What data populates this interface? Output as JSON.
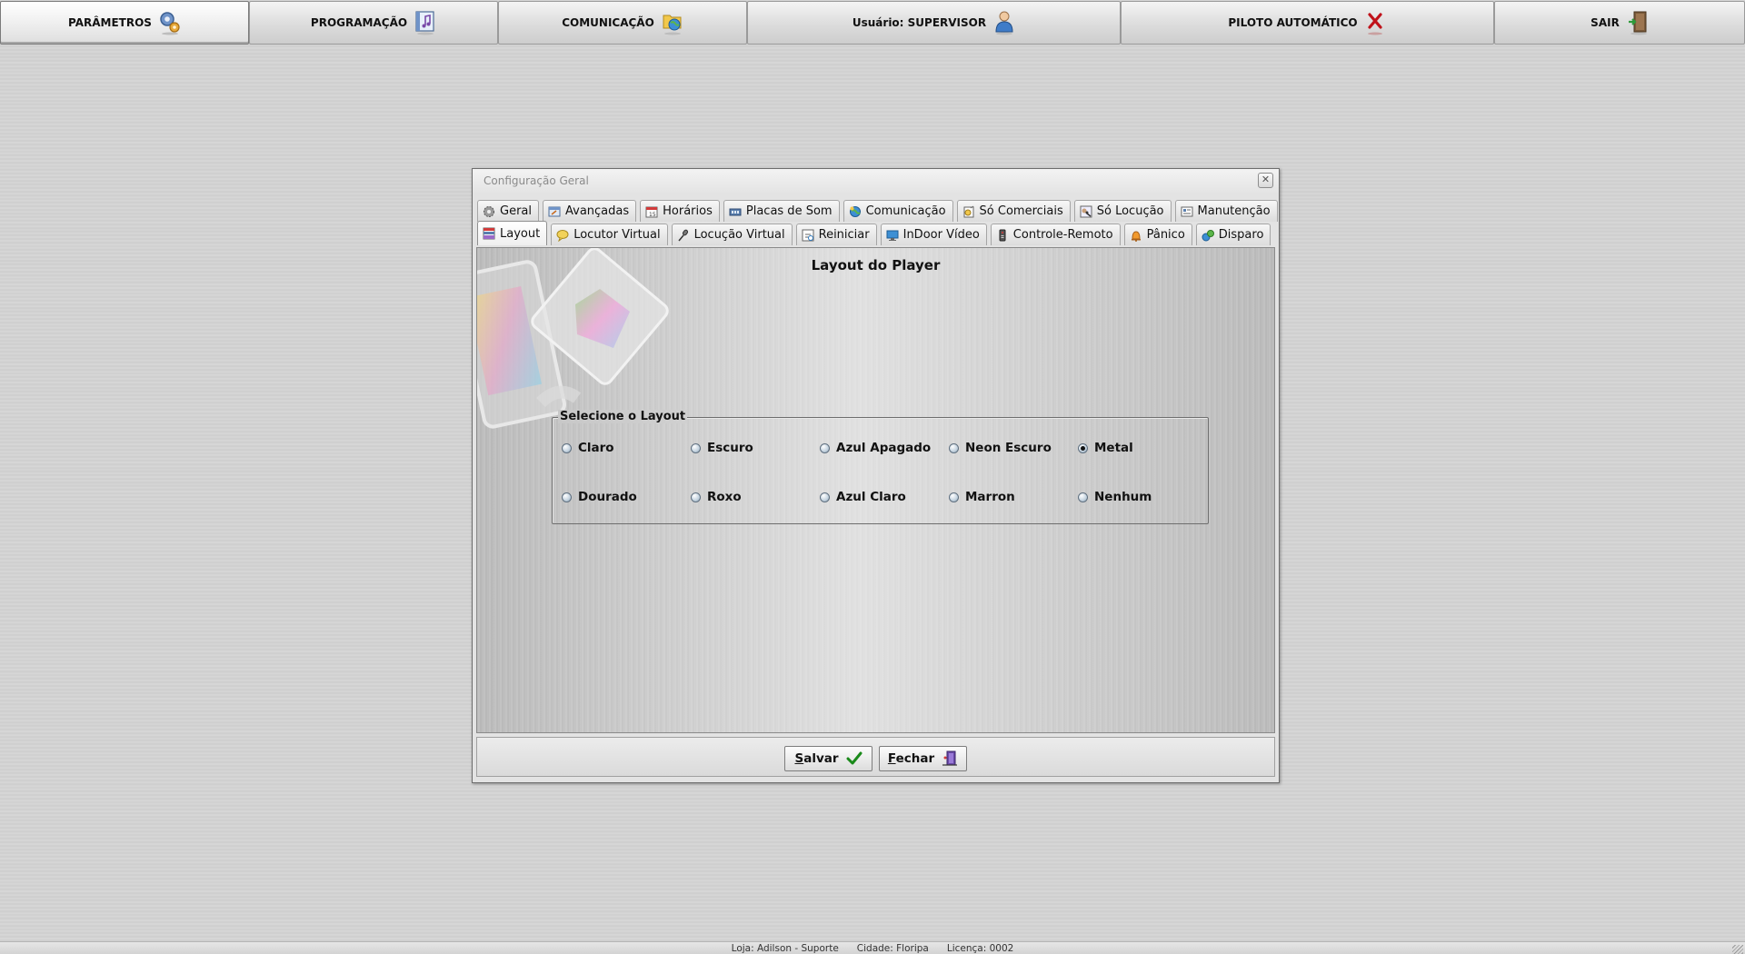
{
  "topmenu": {
    "items": [
      {
        "label": "PARÂMETROS",
        "icon": "gears-icon"
      },
      {
        "label": "PROGRAMAÇÃO",
        "icon": "music-sheet-icon"
      },
      {
        "label": "COMUNICAÇÃO",
        "icon": "globe-folder-icon"
      },
      {
        "label": "Usuário: SUPERVISOR",
        "icon": "user-icon"
      },
      {
        "label": "PILOTO AUTOMÁTICO",
        "icon": "red-x-icon"
      },
      {
        "label": "SAIR",
        "icon": "exit-door-icon"
      }
    ],
    "active": "PARÂMETROS"
  },
  "dialog": {
    "title": "Configuração Geral",
    "tabs_row1": [
      "Geral",
      "Avançadas",
      "Horários",
      "Placas de Som",
      "Comunicação",
      "Só Comerciais",
      "Só Locução",
      "Manutenção"
    ],
    "tabs_row2": [
      "Layout",
      "Locutor Virtual",
      "Locução Virtual",
      "Reiniciar",
      "InDoor Vídeo",
      "Controle-Remoto",
      "Pânico",
      "Disparo"
    ],
    "selected_tab": "Layout",
    "panel_title": "Layout do Player",
    "group_label": "Selecione o Layout",
    "options": [
      "Claro",
      "Escuro",
      "Azul Apagado",
      "Neon Escuro",
      "Metal",
      "Dourado",
      "Roxo",
      "Azul Claro",
      "Marron",
      "Nenhum"
    ],
    "selected_option": "Metal",
    "save_key": "S",
    "save_rest": "alvar",
    "close_key": "F",
    "close_rest": "echar"
  },
  "status": {
    "loja": "Loja: Adilson - Suporte",
    "cidade": "Cidade: Floripa",
    "licenca": "Licença: 0002"
  },
  "colors": {
    "accent_check": "#1a8a1a",
    "close_x": "#c0121a"
  }
}
